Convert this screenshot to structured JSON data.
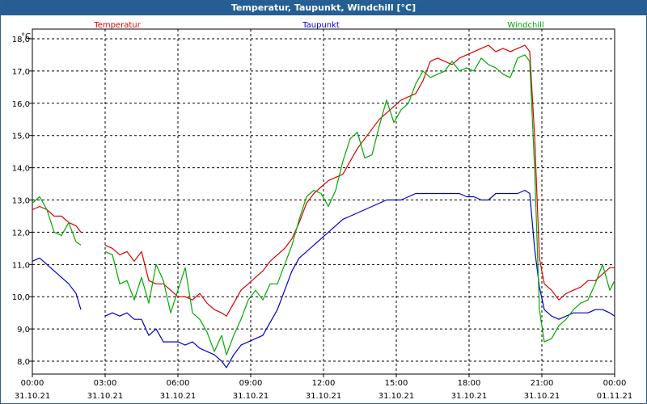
{
  "window": {
    "title": "Temperatur, Taupunkt, Windchill [°C]"
  },
  "chart_data": {
    "type": "line",
    "title": "Temperatur, Taupunkt, Windchill [°C]",
    "ylabel": "°C",
    "ylim": [
      7.6,
      18.3
    ],
    "yticks": [
      "8,0",
      "9,0",
      "10,0",
      "11,0",
      "12,0",
      "13,0",
      "14,0",
      "15,0",
      "16,0",
      "17,0",
      "18,0"
    ],
    "xlim": [
      0,
      24
    ],
    "xticks": [
      {
        "time": "00:00",
        "date": "31.10.21"
      },
      {
        "time": "03:00",
        "date": "31.10.21"
      },
      {
        "time": "06:00",
        "date": "31.10.21"
      },
      {
        "time": "09:00",
        "date": "31.10.21"
      },
      {
        "time": "12:00",
        "date": "31.10.21"
      },
      {
        "time": "15:00",
        "date": "31.10.21"
      },
      {
        "time": "18:00",
        "date": "31.10.21"
      },
      {
        "time": "21:00",
        "date": "31.10.21"
      },
      {
        "time": "00:00",
        "date": "01.11.21"
      }
    ],
    "grid": true,
    "series": [
      {
        "name": "Temperatur",
        "color": "#dd0000",
        "segments": [
          [
            [
              0,
              12.7
            ],
            [
              0.3,
              12.8
            ],
            [
              0.6,
              12.7
            ],
            [
              0.9,
              12.5
            ],
            [
              1.2,
              12.5
            ],
            [
              1.5,
              12.3
            ],
            [
              1.8,
              12.2
            ],
            [
              2.0,
              12.0
            ]
          ],
          [
            [
              3.0,
              11.6
            ],
            [
              3.3,
              11.5
            ],
            [
              3.6,
              11.3
            ],
            [
              3.9,
              11.4
            ],
            [
              4.2,
              11.1
            ],
            [
              4.5,
              11.4
            ],
            [
              4.8,
              10.5
            ],
            [
              5.1,
              10.4
            ],
            [
              5.4,
              10.4
            ],
            [
              5.7,
              10.2
            ],
            [
              6.0,
              10.0
            ],
            [
              6.3,
              10.0
            ],
            [
              6.6,
              9.9
            ],
            [
              6.9,
              10.1
            ],
            [
              7.2,
              9.8
            ],
            [
              7.5,
              9.6
            ],
            [
              7.8,
              9.5
            ],
            [
              8.0,
              9.4
            ],
            [
              8.3,
              9.8
            ],
            [
              8.6,
              10.2
            ],
            [
              8.9,
              10.4
            ],
            [
              9.2,
              10.6
            ],
            [
              9.5,
              10.8
            ],
            [
              9.8,
              11.1
            ],
            [
              10.1,
              11.3
            ],
            [
              10.4,
              11.5
            ],
            [
              10.7,
              11.8
            ],
            [
              11.0,
              12.3
            ],
            [
              11.3,
              12.9
            ],
            [
              11.6,
              13.2
            ],
            [
              11.9,
              13.4
            ],
            [
              12.2,
              13.6
            ],
            [
              12.5,
              13.7
            ],
            [
              12.8,
              13.8
            ],
            [
              13.1,
              14.2
            ],
            [
              13.4,
              14.6
            ],
            [
              13.7,
              14.9
            ],
            [
              14.0,
              15.2
            ],
            [
              14.3,
              15.5
            ],
            [
              14.6,
              15.7
            ],
            [
              14.9,
              15.9
            ],
            [
              15.2,
              16.1
            ],
            [
              15.5,
              16.2
            ],
            [
              15.8,
              16.3
            ],
            [
              16.1,
              16.7
            ],
            [
              16.4,
              17.3
            ],
            [
              16.7,
              17.4
            ],
            [
              17.0,
              17.3
            ],
            [
              17.3,
              17.2
            ],
            [
              17.6,
              17.4
            ],
            [
              17.9,
              17.5
            ],
            [
              18.2,
              17.6
            ],
            [
              18.5,
              17.7
            ],
            [
              18.8,
              17.8
            ],
            [
              19.1,
              17.6
            ],
            [
              19.4,
              17.7
            ],
            [
              19.7,
              17.6
            ],
            [
              20.0,
              17.7
            ],
            [
              20.3,
              17.8
            ],
            [
              20.5,
              17.6
            ],
            [
              20.7,
              15.0
            ],
            [
              20.9,
              11.2
            ],
            [
              21.1,
              10.4
            ],
            [
              21.4,
              10.2
            ],
            [
              21.7,
              9.9
            ],
            [
              22.0,
              10.1
            ],
            [
              22.3,
              10.2
            ],
            [
              22.6,
              10.3
            ],
            [
              22.9,
              10.5
            ],
            [
              23.2,
              10.5
            ],
            [
              23.5,
              10.7
            ],
            [
              23.8,
              10.9
            ],
            [
              24.0,
              10.9
            ]
          ]
        ]
      },
      {
        "name": "Taupunkt",
        "color": "#0000cc",
        "segments": [
          [
            [
              0,
              11.1
            ],
            [
              0.3,
              11.2
            ],
            [
              0.6,
              11.0
            ],
            [
              0.9,
              10.8
            ],
            [
              1.2,
              10.6
            ],
            [
              1.5,
              10.4
            ],
            [
              1.8,
              10.1
            ],
            [
              2.0,
              9.6
            ]
          ],
          [
            [
              3.0,
              9.4
            ],
            [
              3.3,
              9.5
            ],
            [
              3.6,
              9.4
            ],
            [
              3.9,
              9.5
            ],
            [
              4.2,
              9.3
            ],
            [
              4.5,
              9.3
            ],
            [
              4.8,
              8.8
            ],
            [
              5.1,
              9.0
            ],
            [
              5.4,
              8.6
            ],
            [
              5.7,
              8.6
            ],
            [
              6.0,
              8.6
            ],
            [
              6.3,
              8.5
            ],
            [
              6.6,
              8.6
            ],
            [
              6.9,
              8.4
            ],
            [
              7.2,
              8.3
            ],
            [
              7.5,
              8.2
            ],
            [
              7.8,
              8.0
            ],
            [
              8.0,
              7.8
            ],
            [
              8.3,
              8.2
            ],
            [
              8.6,
              8.5
            ],
            [
              8.9,
              8.6
            ],
            [
              9.2,
              8.7
            ],
            [
              9.5,
              8.8
            ],
            [
              9.8,
              9.2
            ],
            [
              10.1,
              9.6
            ],
            [
              10.4,
              10.2
            ],
            [
              10.7,
              10.8
            ],
            [
              11.0,
              11.2
            ],
            [
              11.3,
              11.4
            ],
            [
              11.6,
              11.6
            ],
            [
              11.9,
              11.8
            ],
            [
              12.2,
              12.0
            ],
            [
              12.5,
              12.2
            ],
            [
              12.8,
              12.4
            ],
            [
              13.1,
              12.5
            ],
            [
              13.4,
              12.6
            ],
            [
              13.7,
              12.7
            ],
            [
              14.0,
              12.8
            ],
            [
              14.3,
              12.9
            ],
            [
              14.6,
              13.0
            ],
            [
              14.9,
              13.0
            ],
            [
              15.2,
              13.0
            ],
            [
              15.5,
              13.1
            ],
            [
              15.8,
              13.2
            ],
            [
              16.1,
              13.2
            ],
            [
              16.4,
              13.2
            ],
            [
              16.7,
              13.2
            ],
            [
              17.0,
              13.2
            ],
            [
              17.3,
              13.2
            ],
            [
              17.6,
              13.2
            ],
            [
              17.9,
              13.1
            ],
            [
              18.2,
              13.1
            ],
            [
              18.5,
              13.0
            ],
            [
              18.8,
              13.0
            ],
            [
              19.1,
              13.2
            ],
            [
              19.4,
              13.2
            ],
            [
              19.7,
              13.2
            ],
            [
              20.0,
              13.2
            ],
            [
              20.3,
              13.3
            ],
            [
              20.5,
              13.2
            ],
            [
              20.7,
              11.5
            ],
            [
              20.9,
              10.3
            ],
            [
              21.1,
              9.6
            ],
            [
              21.4,
              9.4
            ],
            [
              21.7,
              9.3
            ],
            [
              22.0,
              9.4
            ],
            [
              22.3,
              9.5
            ],
            [
              22.6,
              9.5
            ],
            [
              22.9,
              9.5
            ],
            [
              23.2,
              9.6
            ],
            [
              23.5,
              9.6
            ],
            [
              23.8,
              9.5
            ],
            [
              24.0,
              9.4
            ]
          ]
        ]
      },
      {
        "name": "Windchill",
        "color": "#00aa00",
        "segments": [
          [
            [
              0,
              12.9
            ],
            [
              0.3,
              13.1
            ],
            [
              0.6,
              12.7
            ],
            [
              0.9,
              12.0
            ],
            [
              1.2,
              11.9
            ],
            [
              1.5,
              12.3
            ],
            [
              1.8,
              11.7
            ],
            [
              2.0,
              11.6
            ]
          ],
          [
            [
              3.0,
              11.4
            ],
            [
              3.3,
              11.3
            ],
            [
              3.6,
              10.4
            ],
            [
              3.9,
              10.5
            ],
            [
              4.2,
              9.9
            ],
            [
              4.5,
              10.6
            ],
            [
              4.8,
              9.8
            ],
            [
              5.1,
              11.0
            ],
            [
              5.4,
              10.5
            ],
            [
              5.7,
              9.5
            ],
            [
              6.0,
              10.2
            ],
            [
              6.3,
              10.9
            ],
            [
              6.6,
              9.5
            ],
            [
              6.9,
              9.3
            ],
            [
              7.2,
              8.9
            ],
            [
              7.5,
              8.3
            ],
            [
              7.8,
              8.8
            ],
            [
              8.0,
              8.2
            ],
            [
              8.3,
              8.8
            ],
            [
              8.6,
              9.3
            ],
            [
              8.9,
              9.9
            ],
            [
              9.2,
              10.2
            ],
            [
              9.5,
              9.9
            ],
            [
              9.8,
              10.4
            ],
            [
              10.1,
              10.4
            ],
            [
              10.4,
              11.0
            ],
            [
              10.7,
              11.6
            ],
            [
              11.0,
              12.4
            ],
            [
              11.3,
              13.1
            ],
            [
              11.6,
              13.3
            ],
            [
              11.9,
              13.2
            ],
            [
              12.2,
              12.8
            ],
            [
              12.5,
              13.3
            ],
            [
              12.8,
              14.2
            ],
            [
              13.1,
              14.9
            ],
            [
              13.4,
              15.1
            ],
            [
              13.7,
              14.3
            ],
            [
              14.0,
              14.4
            ],
            [
              14.3,
              15.3
            ],
            [
              14.6,
              16.1
            ],
            [
              14.9,
              15.4
            ],
            [
              15.2,
              15.8
            ],
            [
              15.5,
              16.0
            ],
            [
              15.8,
              16.6
            ],
            [
              16.1,
              17.0
            ],
            [
              16.4,
              16.8
            ],
            [
              16.7,
              16.9
            ],
            [
              17.0,
              17.0
            ],
            [
              17.3,
              17.3
            ],
            [
              17.6,
              17.0
            ],
            [
              17.9,
              17.1
            ],
            [
              18.2,
              17.0
            ],
            [
              18.5,
              17.4
            ],
            [
              18.8,
              17.2
            ],
            [
              19.1,
              17.1
            ],
            [
              19.4,
              16.9
            ],
            [
              19.7,
              16.8
            ],
            [
              20.0,
              17.4
            ],
            [
              20.3,
              17.5
            ],
            [
              20.5,
              17.3
            ],
            [
              20.7,
              14.0
            ],
            [
              20.9,
              9.6
            ],
            [
              21.1,
              8.6
            ],
            [
              21.4,
              8.7
            ],
            [
              21.7,
              9.1
            ],
            [
              22.0,
              9.3
            ],
            [
              22.3,
              9.6
            ],
            [
              22.6,
              9.8
            ],
            [
              22.9,
              9.9
            ],
            [
              23.2,
              10.4
            ],
            [
              23.5,
              11.0
            ],
            [
              23.8,
              10.2
            ],
            [
              24.0,
              10.5
            ]
          ]
        ]
      }
    ]
  }
}
